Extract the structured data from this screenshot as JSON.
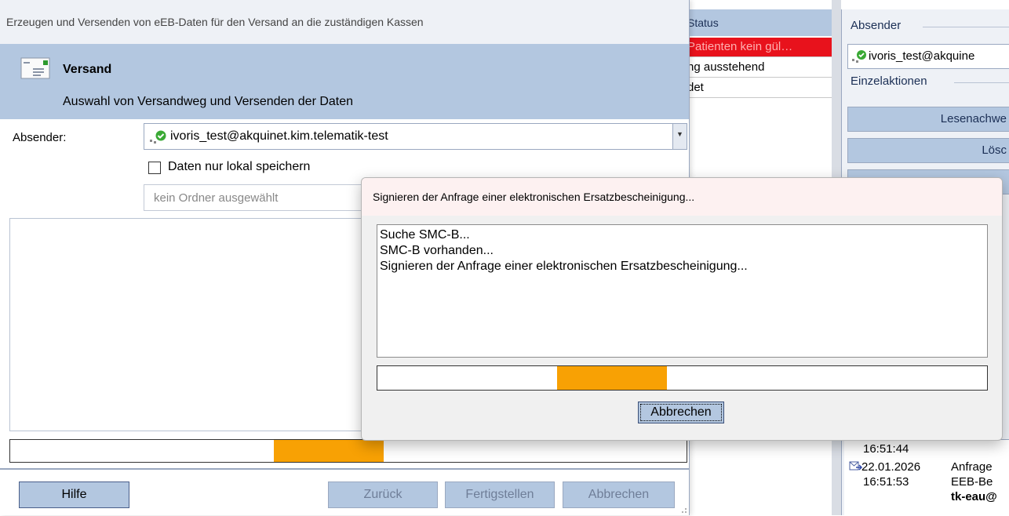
{
  "background": {
    "status_header": "Status",
    "status_rows": [
      "Patienten kein gül…",
      "ng ausstehend",
      "det"
    ],
    "right_panel": {
      "sender_group_label": "Absender",
      "sender_value": "ivoris_test@akquine",
      "actions_group_label": "Einzelaktionen",
      "buttons": [
        "Lesenachwe",
        "Lösc"
      ],
      "log": [
        {
          "time": "16:51:44"
        },
        {
          "date": "22.01.2026",
          "time": "16:51:53",
          "text1": "Anfrage",
          "text2": "EEB-Be",
          "text3": "tk-eau@"
        }
      ]
    },
    "colors": {
      "error_row": "#e8121c",
      "header": "#b3c7e0"
    }
  },
  "wizard": {
    "window_title": "Erzeugen und Versenden von eEB-Daten für den Versand an die zuständigen Kassen",
    "step_icon": "envelope-icon",
    "step_title": "Versand",
    "step_subtitle": "Auswahl von Versandweg und Versenden der Daten",
    "sender_label": "Absender:",
    "sender_value": "ivoris_test@akquinet.kim.telematik-test",
    "sender_icon": "kim-account-icon",
    "local_save_label": "Daten nur lokal speichern",
    "local_save_checked": false,
    "folder_placeholder": "kein Ordner ausgewählt",
    "buttons": {
      "help": "Hilfe",
      "back": "Zurück",
      "finish": "Fertigstellen",
      "cancel": "Abbrechen"
    },
    "colors": {
      "header": "#b3c7e0",
      "progress": "#f8a104"
    }
  },
  "sign_dialog": {
    "title": "Signieren der Anfrage einer elektronischen Ersatzbescheinigung...",
    "log_lines": [
      "Suche SMC-B...",
      "SMC-B vorhanden...",
      "Signieren der Anfrage einer elektronischen Ersatzbescheinigung..."
    ],
    "cancel_label": "Abbrechen",
    "progress_indeterminate": true
  }
}
